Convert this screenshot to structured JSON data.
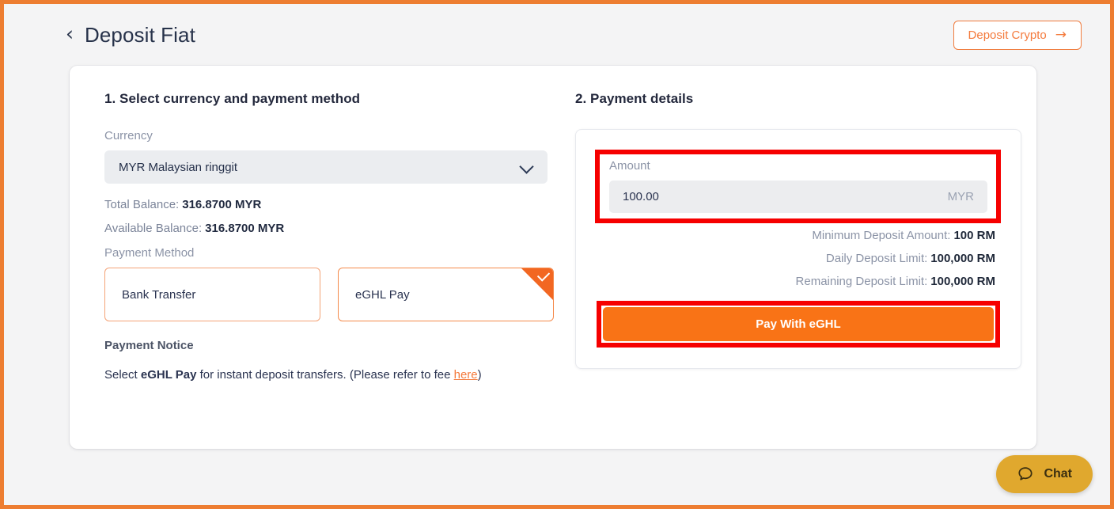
{
  "frame": {
    "accent_color": "#ED7D31",
    "annotation_color": "#F60000",
    "background": "#f4f4f5"
  },
  "header": {
    "back_icon": "chevron-left",
    "title": "Deposit Fiat",
    "deposit_crypto": {
      "label": "Deposit Crypto",
      "arrow": "→",
      "color": "#F47A3C"
    }
  },
  "left_column": {
    "step_title": "1. Select currency and payment method",
    "currency": {
      "label": "Currency",
      "selected": "MYR Malaysian ringgit",
      "chevron": "chevron-down"
    },
    "balances": [
      {
        "label": "Total Balance:",
        "value": "316.8700 MYR"
      },
      {
        "label": "Available Balance:",
        "value": "316.8700 MYR"
      }
    ],
    "payment_method": {
      "label": "Payment Method",
      "options": [
        {
          "label": "Bank Transfer",
          "selected": false
        },
        {
          "label": "eGHL Pay",
          "selected": true
        }
      ]
    },
    "payment_notice": {
      "title": "Payment Notice",
      "prefix": "Select ",
      "bold": "eGHL Pay",
      "middle": " for instant deposit transfers. (Please refer to fee ",
      "link": "here",
      "suffix": ")"
    }
  },
  "right_column": {
    "step_title": "2. Payment details",
    "amount": {
      "label": "Amount",
      "value": "100.00",
      "placeholder": "0.00",
      "currency": "MYR"
    },
    "limits": [
      {
        "label": "Minimum Deposit Amount:",
        "value": "100 RM"
      },
      {
        "label": "Daily Deposit Limit:",
        "value": "100,000 RM"
      },
      {
        "label": "Remaining Deposit Limit:",
        "value": "100,000 RM"
      }
    ],
    "pay_button": {
      "label": "Pay With eGHL",
      "color": "#F97316"
    }
  },
  "chat": {
    "label": "Chat",
    "icon": "speech-bubble",
    "color": "#E0A82E"
  }
}
